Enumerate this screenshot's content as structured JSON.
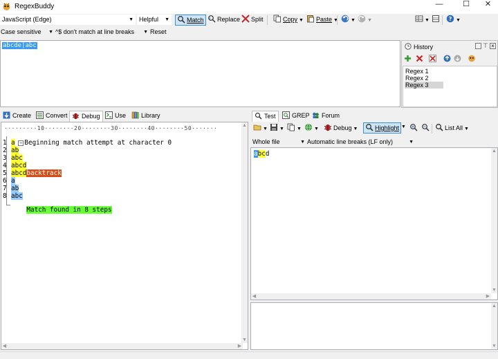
{
  "window": {
    "title": "RegexBuddy",
    "min_glyph": "—",
    "max_glyph": "☐",
    "close_glyph": "✕"
  },
  "toolbar": {
    "flavor": "JavaScript (Edge)",
    "helpful": "Helpful",
    "match": "Match",
    "replace": "Replace",
    "split": "Split",
    "copy": "Copy",
    "paste": "Paste"
  },
  "options": {
    "case": "Case sensitive",
    "line_breaks": "^$ don't match at line breaks",
    "reset": "Reset"
  },
  "regex": {
    "text": "abcde|abc"
  },
  "history": {
    "title": "History",
    "items": [
      "Regex 1",
      "Regex 2",
      "Regex 3"
    ],
    "selected_index": 2
  },
  "left_tabs": [
    "Create",
    "Convert",
    "Debug",
    "Use",
    "Library"
  ],
  "left_active_tab": "Debug",
  "debug": {
    "ruler": "·········10········20········30········40········50·······",
    "header": "Beginning match attempt at character 0",
    "lines": [
      {
        "num": "1",
        "text": "a",
        "style": "y",
        "extra": ""
      },
      {
        "num": "2",
        "text": "ab",
        "style": "y",
        "extra": ""
      },
      {
        "num": "3",
        "text": "abc",
        "style": "y",
        "extra": ""
      },
      {
        "num": "4",
        "text": "abcd",
        "style": "y",
        "extra": ""
      },
      {
        "num": "5",
        "text": "abcd",
        "style": "y",
        "extra": "backtrack"
      },
      {
        "num": "6",
        "text": "a",
        "style": "b",
        "extra": ""
      },
      {
        "num": "7",
        "text": "ab",
        "style": "b",
        "extra": ""
      },
      {
        "num": "8",
        "text": "abc",
        "style": "b",
        "extra": ""
      }
    ],
    "footer": "Match found in 8 steps"
  },
  "right_tabs": [
    "Test",
    "GREP",
    "Forum"
  ],
  "right_active_tab": "Test",
  "test_toolbar": {
    "debug": "Debug",
    "highlight": "Highlight",
    "list_all": "List All",
    "scope": "Whole file",
    "line_breaks": "Automatic line breaks (LF only)"
  },
  "test": {
    "sel": "a",
    "matched": "bc",
    "rest": "d"
  },
  "colors": {
    "yellow": "#ffff33",
    "blue": "#99ccff",
    "backtrack": "#d64d1a",
    "green": "#66ff33",
    "selection": "#3399ff"
  }
}
